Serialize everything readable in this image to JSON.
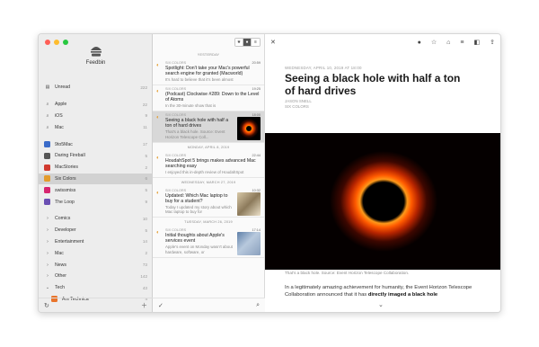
{
  "sidebar": {
    "app_name": "Feedbin",
    "items": [
      {
        "icon": "inbox-icon",
        "glyph": "▤",
        "label": "Unread",
        "count": "222",
        "type": "top"
      },
      {
        "gap": true
      },
      {
        "icon": "search-icon",
        "glyph": "⌕",
        "label": "Apple",
        "count": "22",
        "type": "top"
      },
      {
        "icon": "search-icon",
        "glyph": "⌕",
        "label": "iOS",
        "count": "9",
        "type": "top"
      },
      {
        "icon": "search-icon",
        "glyph": "⌕",
        "label": "Mac",
        "count": "11",
        "type": "top"
      },
      {
        "gap": true
      },
      {
        "icon": "feed-icon-9to5mac",
        "fav": "#3a6bc9",
        "label": "9to5Mac",
        "count": "17",
        "type": "feed"
      },
      {
        "icon": "feed-icon-daring-fireball",
        "fav": "#555555",
        "label": "Daring Fireball",
        "count": "5",
        "type": "feed"
      },
      {
        "icon": "feed-icon-macstories",
        "fav": "#d13a2f",
        "label": "MacStories",
        "count": "2",
        "type": "feed"
      },
      {
        "icon": "feed-icon-six-colors",
        "fav": "#e39b2c",
        "label": "Six Colors",
        "count": "6",
        "type": "feed",
        "selected": true
      },
      {
        "icon": "feed-icon-swissmiss",
        "fav": "#d6256f",
        "label": "swissmiss",
        "count": "5",
        "type": "feed"
      },
      {
        "icon": "feed-icon-the-loop",
        "fav": "#6a4fb3",
        "label": "The Loop",
        "count": "9",
        "type": "feed"
      },
      {
        "gap": true
      },
      {
        "icon": "chevron-right-icon",
        "glyph": "›",
        "label": "Comics",
        "count": "10",
        "type": "folder"
      },
      {
        "icon": "chevron-right-icon",
        "glyph": "›",
        "label": "Developer",
        "count": "5",
        "type": "folder"
      },
      {
        "icon": "chevron-right-icon",
        "glyph": "›",
        "label": "Entertainment",
        "count": "14",
        "type": "folder"
      },
      {
        "icon": "chevron-right-icon",
        "glyph": "›",
        "label": "Mac",
        "count": "2",
        "type": "folder"
      },
      {
        "icon": "chevron-right-icon",
        "glyph": "›",
        "label": "News",
        "count": "73",
        "type": "folder"
      },
      {
        "icon": "chevron-right-icon",
        "glyph": "›",
        "label": "Other",
        "count": "142",
        "type": "folder"
      },
      {
        "icon": "chevron-down-icon",
        "glyph": "⌄",
        "label": "Tech",
        "count": "43",
        "type": "folder"
      },
      {
        "icon": "feed-icon-ars-technica",
        "fav": "#e9742b",
        "label": "Ars Technica",
        "count": "4",
        "type": "child"
      }
    ]
  },
  "list": {
    "toolbar": [
      "★",
      "●",
      "≡"
    ],
    "groups": [
      {
        "date": "YESTERDAY",
        "entries": [
          {
            "source": "SIX COLORS",
            "time": "20:59",
            "title": "Spotlight: Don't take your Mac's powerful search engine for granted (Macworld)",
            "summary": "It's hard to believe that it's been almost",
            "thumb": ""
          },
          {
            "source": "SIX COLORS",
            "time": "19:25",
            "title": "(Podcast) Clockwise #289: Down to the Level of Atoms",
            "summary": "In the 30-minute show that is",
            "thumb": ""
          },
          {
            "source": "SIX COLORS",
            "time": "18:00",
            "title": "Seeing a black hole with half a ton of hard drives",
            "summary": "That's a black hole. Source: Event Horizon Telescope Coll...",
            "thumb": "bh",
            "selected": true
          }
        ]
      },
      {
        "date": "MONDAY, APRIL 8, 2019",
        "entries": [
          {
            "source": "SIX COLORS",
            "time": "22:44",
            "title": "HoudahSpot 5 brings makes advanced Mac searching easy",
            "summary": "I enjoyed this in-depth review of HoudahSpot",
            "thumb": ""
          }
        ]
      },
      {
        "date": "WEDNESDAY, MARCH 27, 2019",
        "entries": [
          {
            "source": "SIX COLORS",
            "time": "10:32",
            "title": "Updated: Which Mac laptop to buy for a student?",
            "summary": "Today I updated my story about which Mac laptop to buy for",
            "thumb": "mac1"
          }
        ]
      },
      {
        "date": "TUESDAY, MARCH 26, 2019",
        "entries": [
          {
            "source": "SIX COLORS",
            "time": "17:14",
            "title": "Initial thoughts about Apple's services event",
            "summary": "Apple's event on Monday wasn't about hardware, software, or",
            "thumb": "mac2"
          }
        ]
      }
    ]
  },
  "reader": {
    "date": "WEDNESDAY, APRIL 10, 2019 AT 18:00",
    "title": "Seeing a black hole with half a ton of hard drives",
    "author_line1": "JASON SNELL",
    "author_line2": "SIX COLORS",
    "caption": "That's a black hole. Source: Event Horizon Telescope Collaboration.",
    "body_pre": "In a legitimately amazing achievement for humanity, the Event Horizon Telescope Collaboration announced that it has ",
    "body_bold": "directly imaged a black hole"
  }
}
